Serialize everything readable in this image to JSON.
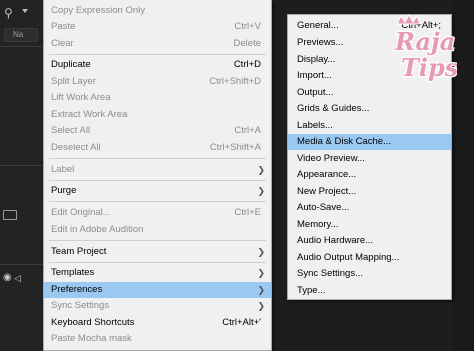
{
  "app": {
    "tab_label": "Na"
  },
  "menu": {
    "items": [
      {
        "label": "Copy Expression Only"
      },
      {
        "label": "Paste",
        "shortcut": "Ctrl+V"
      },
      {
        "label": "Clear",
        "shortcut": "Delete"
      },
      {
        "label": "Duplicate",
        "shortcut": "Ctrl+D"
      },
      {
        "label": "Split Layer",
        "shortcut": "Ctrl+Shift+D"
      },
      {
        "label": "Lift Work Area"
      },
      {
        "label": "Extract Work Area"
      },
      {
        "label": "Select All",
        "shortcut": "Ctrl+A"
      },
      {
        "label": "Deselect All",
        "shortcut": "Ctrl+Shift+A"
      },
      {
        "label": "Label"
      },
      {
        "label": "Purge"
      },
      {
        "label": "Edit Original...",
        "shortcut": "Ctrl+E"
      },
      {
        "label": "Edit in Adobe Audition"
      },
      {
        "label": "Team Project"
      },
      {
        "label": "Templates"
      },
      {
        "label": "Preferences"
      },
      {
        "label": "Sync Settings"
      },
      {
        "label": "Keyboard Shortcuts",
        "shortcut": "Ctrl+Alt+'"
      },
      {
        "label": "Paste Mocha mask"
      }
    ]
  },
  "submenu": {
    "items": [
      {
        "label": "General...",
        "shortcut": "Ctrl+Alt+;"
      },
      {
        "label": "Previews..."
      },
      {
        "label": "Display..."
      },
      {
        "label": "Import..."
      },
      {
        "label": "Output..."
      },
      {
        "label": "Grids & Guides..."
      },
      {
        "label": "Labels..."
      },
      {
        "label": "Media & Disk Cache..."
      },
      {
        "label": "Video Preview..."
      },
      {
        "label": "Appearance..."
      },
      {
        "label": "New Project..."
      },
      {
        "label": "Auto-Save..."
      },
      {
        "label": "Memory..."
      },
      {
        "label": "Audio Hardware..."
      },
      {
        "label": "Audio Output Mapping..."
      },
      {
        "label": "Sync Settings..."
      },
      {
        "label": "Type..."
      }
    ]
  },
  "watermark": {
    "text": "Raja Tips"
  },
  "colors": {
    "menu_background": "#f0f0f0",
    "highlight": "#99c9f2",
    "disabled_text": "#8c8c8c",
    "app_background": "#1d1d1d"
  }
}
